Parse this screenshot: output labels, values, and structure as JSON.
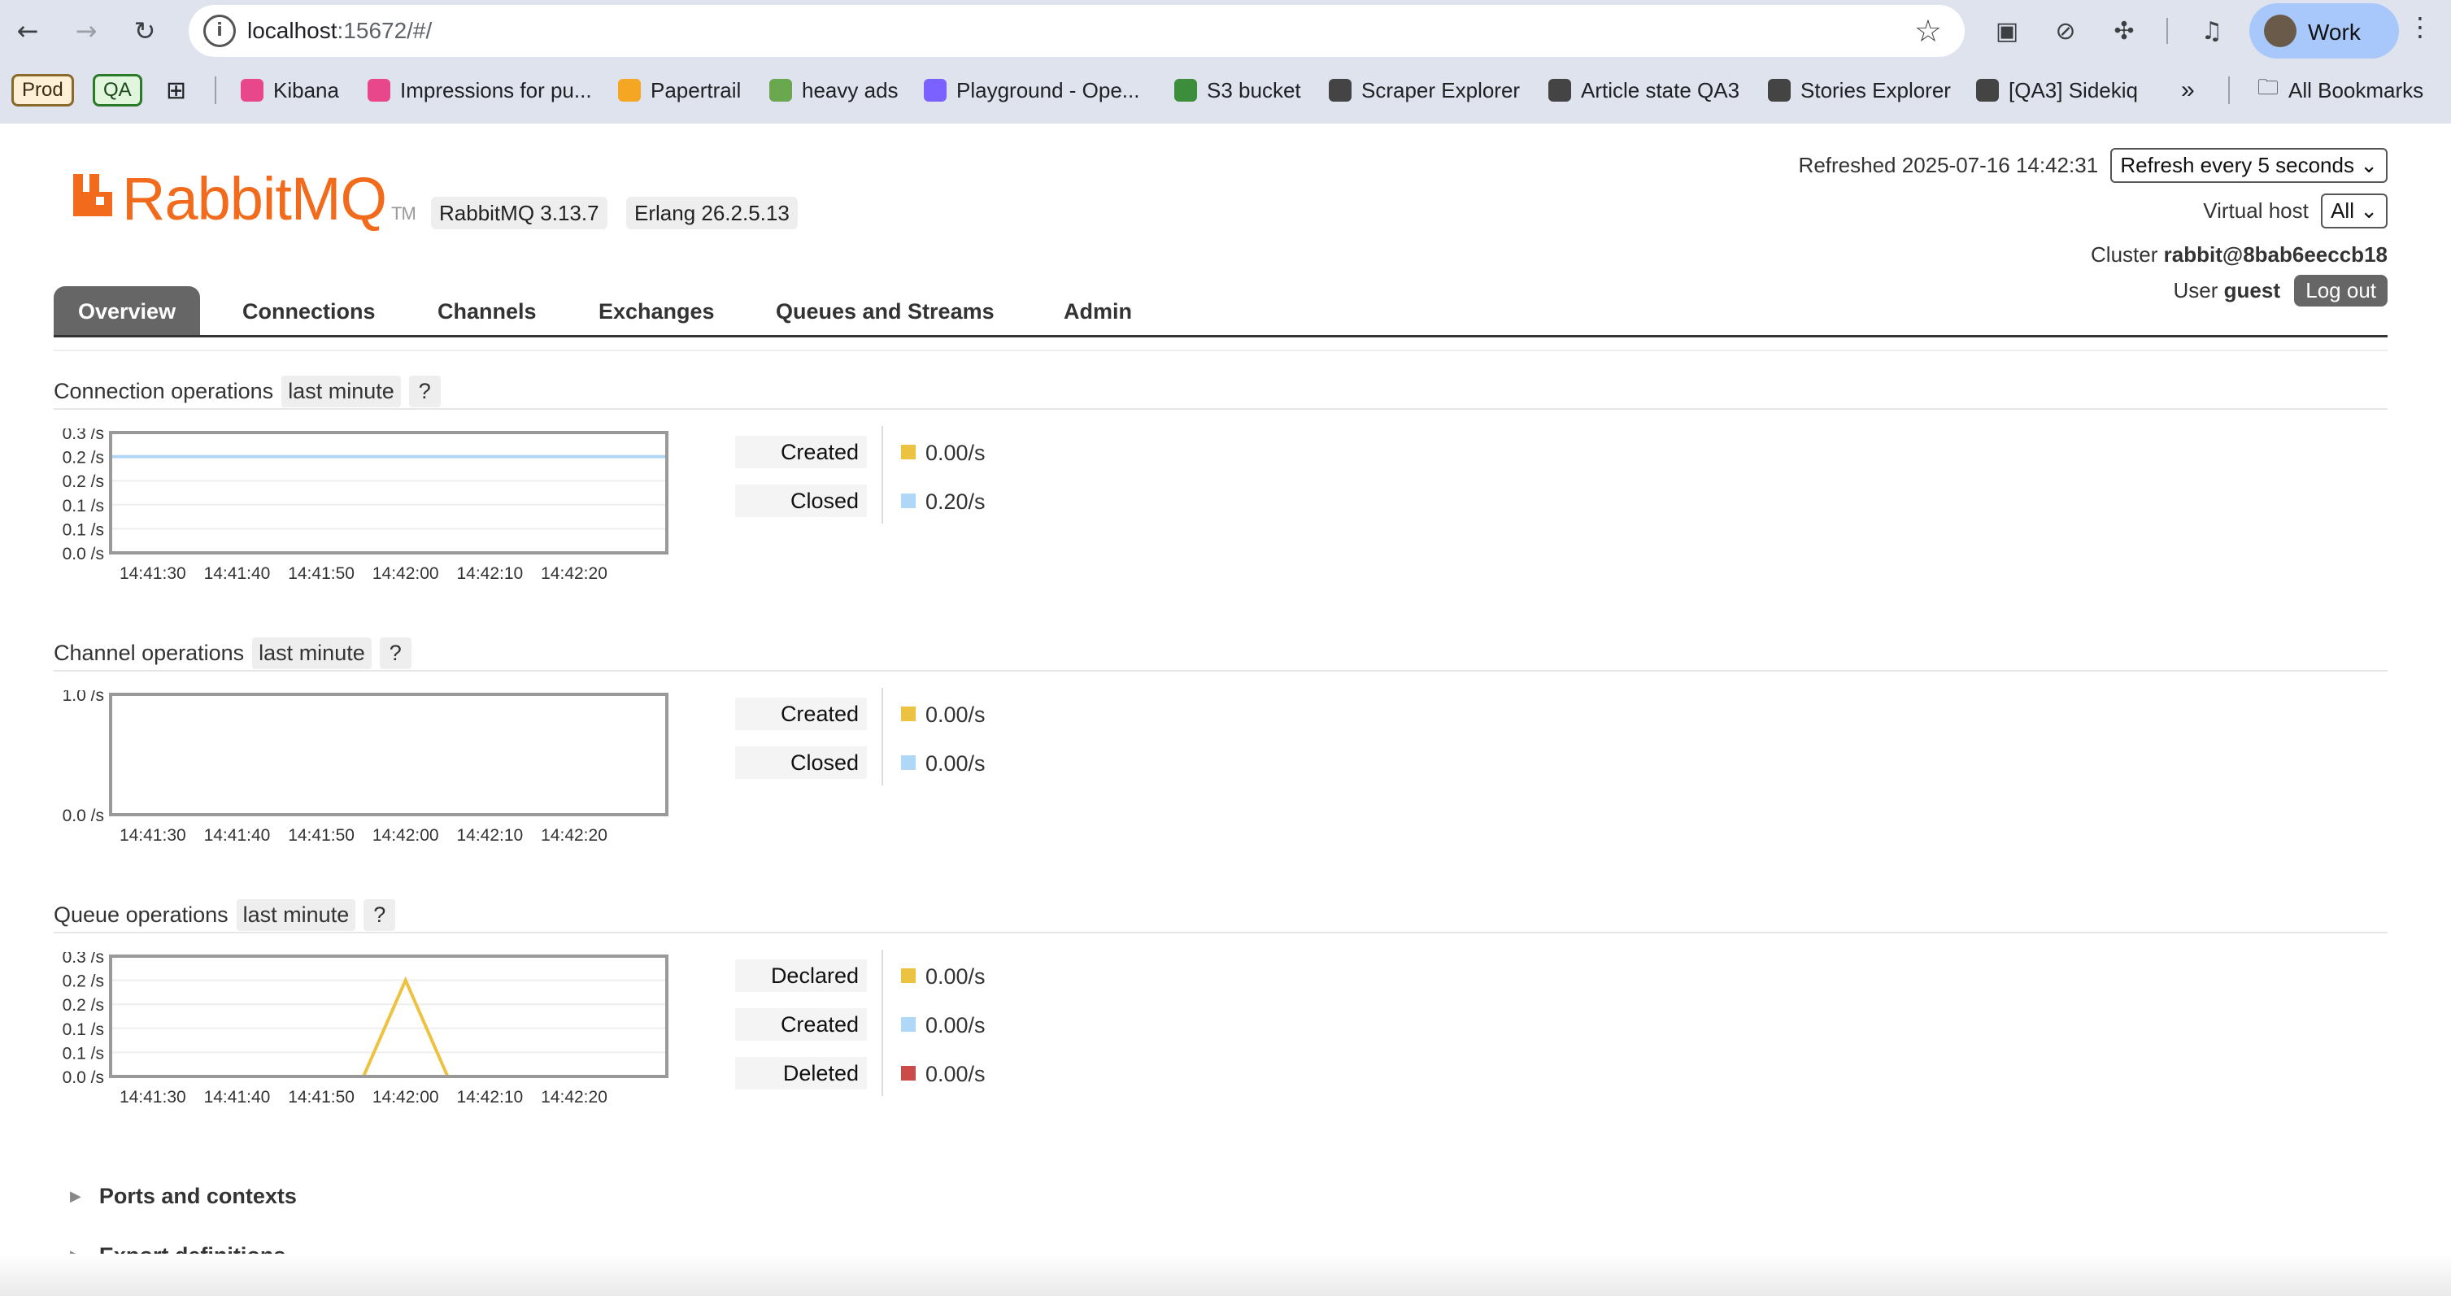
{
  "browser": {
    "url_host": "localhost",
    "url_rest": ":15672/#/",
    "profile_name": "Work",
    "bookmarks": [
      {
        "label": "Prod",
        "pill": true
      },
      {
        "label": "QA",
        "pill": true
      },
      {
        "label": "Kibana",
        "color": "#e8478b"
      },
      {
        "label": "Impressions for pu...",
        "color": "#e8478b"
      },
      {
        "label": "Papertrail",
        "color": "#f5a623"
      },
      {
        "label": "heavy ads",
        "color": "#6aa84f"
      },
      {
        "label": "Playground - Ope...",
        "color": "#7b61ff"
      },
      {
        "label": "S3 bucket",
        "color": "#3c8d3c"
      },
      {
        "label": "Scraper Explorer",
        "color": "#444444"
      },
      {
        "label": "Article state QA3",
        "color": "#444444"
      },
      {
        "label": "Stories Explorer",
        "color": "#444444"
      },
      {
        "label": "[QA3] Sidekiq",
        "color": "#444444"
      }
    ],
    "all_bookmarks": "All Bookmarks",
    "more": "»"
  },
  "app": {
    "logo_text": "RabbitMQ",
    "logo_tm": "TM",
    "version": "RabbitMQ 3.13.7",
    "erlang": "Erlang 26.2.5.13",
    "refreshed_label": "Refreshed 2025-07-16 14:42:31",
    "refresh_select": "Refresh every 5 seconds",
    "vhost_label": "Virtual host",
    "vhost_value": "All",
    "cluster_label": "Cluster",
    "cluster_value": "rabbit@8bab6eeccb18",
    "user_label": "User",
    "user_value": "guest",
    "logout": "Log out",
    "brand_color": "#f26b1d"
  },
  "tabs": [
    "Overview",
    "Connections",
    "Channels",
    "Exchanges",
    "Queues and Streams",
    "Admin"
  ],
  "sections": [
    {
      "title": "Connection operations",
      "range": "last minute",
      "help": "?",
      "y_ticks": [
        "0.3 /s",
        "0.2 /s",
        "0.2 /s",
        "0.1 /s",
        "0.1 /s",
        "0.0 /s"
      ],
      "legend": [
        {
          "label": "Created",
          "value": "0.00/s",
          "color": "#edc240"
        },
        {
          "label": "Closed",
          "value": "0.20/s",
          "color": "#afd8f8"
        }
      ]
    },
    {
      "title": "Channel operations",
      "range": "last minute",
      "help": "?",
      "y_ticks": [
        "1.0 /s",
        "0.0 /s"
      ],
      "legend": [
        {
          "label": "Created",
          "value": "0.00/s",
          "color": "#edc240"
        },
        {
          "label": "Closed",
          "value": "0.00/s",
          "color": "#afd8f8"
        }
      ]
    },
    {
      "title": "Queue operations",
      "range": "last minute",
      "help": "?",
      "y_ticks": [
        "0.3 /s",
        "0.2 /s",
        "0.2 /s",
        "0.1 /s",
        "0.1 /s",
        "0.0 /s"
      ],
      "legend": [
        {
          "label": "Declared",
          "value": "0.00/s",
          "color": "#edc240"
        },
        {
          "label": "Created",
          "value": "0.00/s",
          "color": "#afd8f8"
        },
        {
          "label": "Deleted",
          "value": "0.00/s",
          "color": "#cb4b4b"
        }
      ]
    }
  ],
  "collapsibles": [
    "Ports and contexts",
    "Export definitions"
  ],
  "chart_data": [
    {
      "type": "line",
      "x_ticks": [
        "14:41:30",
        "14:41:40",
        "14:41:50",
        "14:42:00",
        "14:42:10",
        "14:42:20"
      ],
      "ylim": [
        0,
        0.25
      ],
      "series": [
        {
          "name": "Created",
          "color": "#edc240",
          "x": [
            "14:41:25",
            "14:42:31"
          ],
          "values": [
            0.0,
            0.0
          ]
        },
        {
          "name": "Closed",
          "color": "#afd8f8",
          "x": [
            "14:41:25",
            "14:42:31"
          ],
          "values": [
            0.2,
            0.2
          ]
        }
      ]
    },
    {
      "type": "line",
      "x_ticks": [
        "14:41:30",
        "14:41:40",
        "14:41:50",
        "14:42:00",
        "14:42:10",
        "14:42:20"
      ],
      "ylim": [
        0,
        1.0
      ],
      "series": [
        {
          "name": "Created",
          "color": "#edc240",
          "x": [
            "14:41:25",
            "14:42:31"
          ],
          "values": [
            0.0,
            0.0
          ]
        },
        {
          "name": "Closed",
          "color": "#afd8f8",
          "x": [
            "14:41:25",
            "14:42:31"
          ],
          "values": [
            0.0,
            0.0
          ]
        }
      ]
    },
    {
      "type": "line",
      "x_ticks": [
        "14:41:30",
        "14:41:40",
        "14:41:50",
        "14:42:00",
        "14:42:10",
        "14:42:20"
      ],
      "ylim": [
        0,
        0.25
      ],
      "series": [
        {
          "name": "Declared",
          "color": "#edc240",
          "x": [
            "14:41:25",
            "14:41:55",
            "14:42:00",
            "14:42:05",
            "14:42:31"
          ],
          "values": [
            0.0,
            0.0,
            0.2,
            0.0,
            0.0
          ]
        },
        {
          "name": "Created",
          "color": "#afd8f8",
          "x": [
            "14:41:25",
            "14:42:31"
          ],
          "values": [
            0.0,
            0.0
          ]
        },
        {
          "name": "Deleted",
          "color": "#cb4b4b",
          "x": [
            "14:41:25",
            "14:42:31"
          ],
          "values": [
            0.0,
            0.0
          ]
        }
      ]
    }
  ]
}
